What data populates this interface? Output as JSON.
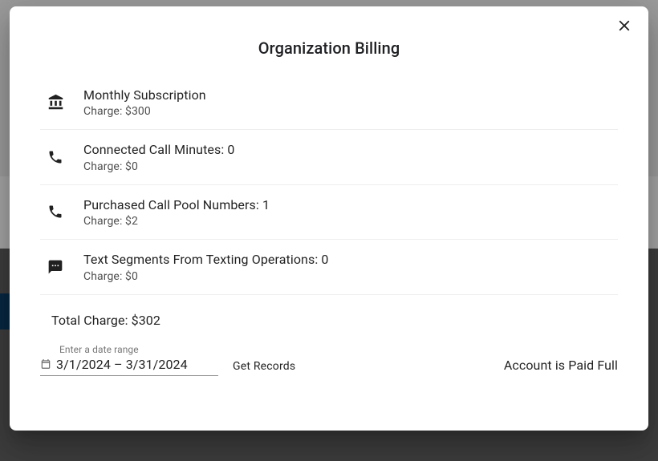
{
  "modal": {
    "title": "Organization Billing",
    "items": [
      {
        "primary": "Monthly Subscription",
        "secondary": "Charge: $300"
      },
      {
        "primary": "Connected Call Minutes: 0",
        "secondary": "Charge: $0"
      },
      {
        "primary": "Purchased Call Pool Numbers: 1",
        "secondary": "Charge: $2"
      },
      {
        "primary": "Text Segments From Texting Operations: 0",
        "secondary": "Charge: $0"
      }
    ],
    "total": "Total Charge: $302",
    "dateField": {
      "label": "Enter a date range",
      "value": "3/1/2024 – 3/31/2024"
    },
    "getRecords": "Get Records",
    "paidStatus": "Account is Paid Full"
  }
}
